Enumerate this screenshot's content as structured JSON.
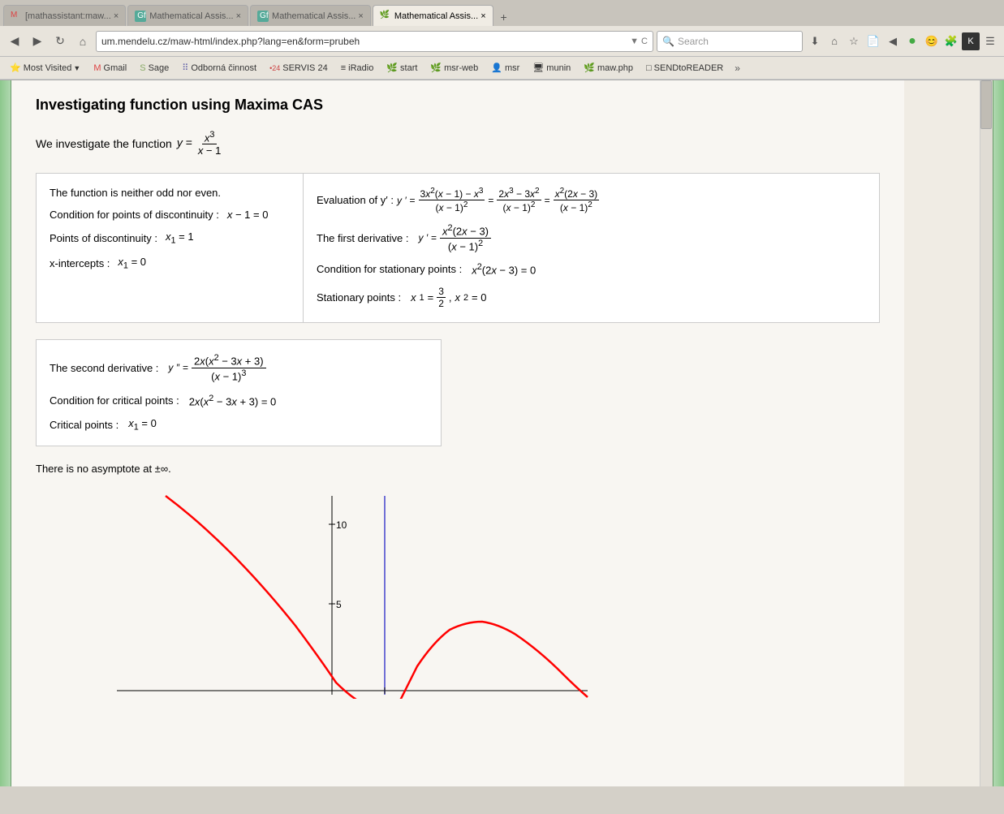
{
  "browser": {
    "tabs": [
      {
        "id": "t1",
        "label": "[mathassistant:maw... ×",
        "active": false,
        "icon": "M"
      },
      {
        "id": "t2",
        "label": "Mathematical Assis... ×",
        "active": false,
        "icon": "Gf"
      },
      {
        "id": "t3",
        "label": "Mathematical Assis... ×",
        "active": false,
        "icon": "Gf"
      },
      {
        "id": "t4",
        "label": "Mathematical Assis... ×",
        "active": true,
        "icon": "leaf"
      },
      {
        "id": "t5",
        "label": "+",
        "active": false,
        "icon": ""
      }
    ],
    "address": "um.mendelu.cz/maw-html/index.php?lang=en&form=prubeh",
    "search_placeholder": "Search",
    "bookmarks": [
      {
        "label": "Most Visited",
        "hasArrow": true,
        "icon": "⭐"
      },
      {
        "label": "Gmail",
        "hasArrow": false,
        "icon": "M"
      },
      {
        "label": "Sage",
        "hasArrow": false,
        "icon": "S"
      },
      {
        "label": "Odborná činnost",
        "hasArrow": false,
        "icon": "::"
      },
      {
        "label": "SERVIS 24",
        "hasArrow": false,
        "icon": "24"
      },
      {
        "label": "iRadio",
        "hasArrow": false,
        "icon": "≡"
      },
      {
        "label": "start",
        "hasArrow": false,
        "icon": "🌿"
      },
      {
        "label": "msr-web",
        "hasArrow": false,
        "icon": "🌿"
      },
      {
        "label": "msr",
        "hasArrow": false,
        "icon": "👤"
      },
      {
        "label": "munin",
        "hasArrow": false,
        "icon": "🖥"
      },
      {
        "label": "maw.php",
        "hasArrow": false,
        "icon": "🌿"
      },
      {
        "label": "SENDtoREADER",
        "hasArrow": false,
        "icon": "□"
      },
      {
        "label": "»",
        "hasArrow": false,
        "icon": ""
      }
    ]
  },
  "page": {
    "title": "Investigating function using Maxima CAS",
    "intro_text": "We investigate the function",
    "content": {
      "box1": {
        "line1": "The function is neither odd nor even.",
        "line2_label": "Condition for points of discontinuity :",
        "line2_math": "x − 1 = 0",
        "line3_label": "Points of discontinuity :",
        "line3_math": "x₁ = 1",
        "line4_label": "x-intercepts :",
        "line4_math": "x₁ = 0"
      },
      "box2": {
        "eval_label": "Evaluation of y′ :",
        "first_deriv_label": "The first derivative :",
        "stationary_cond_label": "Condition for stationary points :",
        "stationary_cond_math": "x² (2x − 3) = 0",
        "stationary_pts_label": "Stationary points :",
        "stationary_pts_math": "x₁ = 3/2,  x₂ = 0"
      },
      "box3": {
        "second_deriv_label": "The second derivative :",
        "critical_cond_label": "Condition for critical points :",
        "critical_cond_math": "2x (x² − 3x + 3) = 0",
        "critical_pts_label": "Critical points :",
        "critical_pts_math": "x₁ = 0"
      },
      "asymptote": "There is no asymptote at ±∞.",
      "graph_y_label_10": "10",
      "graph_y_label_5": "5"
    }
  }
}
